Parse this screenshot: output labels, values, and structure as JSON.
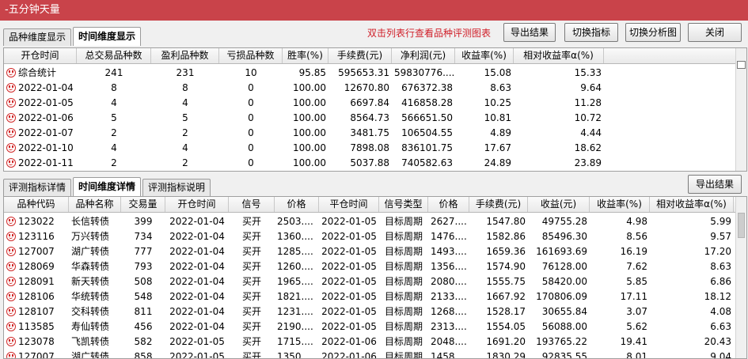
{
  "window": {
    "title": "-五分钟天量"
  },
  "top_tabs": [
    {
      "label": "品种维度显示",
      "active": false
    },
    {
      "label": "时间维度显示",
      "active": true
    }
  ],
  "hint_text": "双击列表行查看品种评测图表",
  "toolbar": {
    "export_label": "导出结果",
    "switch_indicator_label": "切换指标",
    "switch_chart_label": "切换分析图",
    "close_label": "关闭"
  },
  "summary_table": {
    "columns": [
      "开仓时间",
      "总交易品种数",
      "盈利品种数",
      "亏损品种数",
      "胜率(%)",
      "手续费(元)",
      "净利润(元)",
      "收益率(%)",
      "相对收益率α(%)"
    ],
    "rows": [
      [
        "综合统计",
        "241",
        "231",
        "10",
        "95.85",
        "595653.31",
        "59830776....",
        "15.08",
        "15.33"
      ],
      [
        "2022-01-04",
        "8",
        "8",
        "0",
        "100.00",
        "12670.80",
        "676372.38",
        "8.63",
        "9.64"
      ],
      [
        "2022-01-05",
        "4",
        "4",
        "0",
        "100.00",
        "6697.84",
        "416858.28",
        "10.25",
        "11.28"
      ],
      [
        "2022-01-06",
        "5",
        "5",
        "0",
        "100.00",
        "8564.73",
        "566651.50",
        "10.81",
        "10.72"
      ],
      [
        "2022-01-07",
        "2",
        "2",
        "0",
        "100.00",
        "3481.75",
        "106504.55",
        "4.89",
        "4.44"
      ],
      [
        "2022-01-10",
        "4",
        "4",
        "0",
        "100.00",
        "7898.08",
        "836101.75",
        "17.67",
        "18.62"
      ],
      [
        "2022-01-11",
        "2",
        "2",
        "0",
        "100.00",
        "5037.88",
        "740582.63",
        "24.89",
        "23.89"
      ]
    ]
  },
  "bottom_tabs": [
    {
      "label": "评测指标详情",
      "active": false
    },
    {
      "label": "时间维度详情",
      "active": true
    },
    {
      "label": "评测指标说明",
      "active": false
    }
  ],
  "bottom_export_label": "导出结果",
  "detail_table": {
    "columns": [
      "品种代码",
      "品种名称",
      "交易量",
      "开仓时间",
      "信号",
      "价格",
      "平仓时间",
      "信号类型",
      "价格",
      "手续费(元)",
      "收益(元)",
      "收益率(%)",
      "相对收益率α(%)"
    ],
    "rows": [
      [
        "123022",
        "长信转债",
        "399",
        "2022-01-04",
        "买开",
        "2503....",
        "2022-01-05",
        "目标周期",
        "2627....",
        "1547.80",
        "49755.28",
        "4.98",
        "5.99"
      ],
      [
        "123116",
        "万兴转债",
        "734",
        "2022-01-04",
        "买开",
        "1360....",
        "2022-01-05",
        "目标周期",
        "1476....",
        "1582.86",
        "85496.30",
        "8.56",
        "9.57"
      ],
      [
        "127007",
        "湖广转债",
        "777",
        "2022-01-04",
        "买开",
        "1285....",
        "2022-01-05",
        "目标周期",
        "1493....",
        "1659.36",
        "161693.69",
        "16.19",
        "17.20"
      ],
      [
        "128069",
        "华森转债",
        "793",
        "2022-01-04",
        "买开",
        "1260....",
        "2022-01-05",
        "目标周期",
        "1356....",
        "1574.90",
        "76128.00",
        "7.62",
        "8.63"
      ],
      [
        "128091",
        "新天转债",
        "508",
        "2022-01-04",
        "买开",
        "1965....",
        "2022-01-05",
        "目标周期",
        "2080....",
        "1555.75",
        "58420.00",
        "5.85",
        "6.86"
      ],
      [
        "128106",
        "华统转债",
        "548",
        "2022-01-04",
        "买开",
        "1821....",
        "2022-01-05",
        "目标周期",
        "2133....",
        "1667.92",
        "170806.09",
        "17.11",
        "18.12"
      ],
      [
        "128107",
        "交科转债",
        "811",
        "2022-01-04",
        "买开",
        "1231....",
        "2022-01-05",
        "目标周期",
        "1268....",
        "1528.17",
        "30655.84",
        "3.07",
        "4.08"
      ],
      [
        "113585",
        "寿仙转债",
        "456",
        "2022-01-04",
        "买开",
        "2190....",
        "2022-01-05",
        "目标周期",
        "2313....",
        "1554.05",
        "56088.00",
        "5.62",
        "6.63"
      ],
      [
        "123078",
        "飞凯转债",
        "582",
        "2022-01-05",
        "买开",
        "1715....",
        "2022-01-06",
        "目标周期",
        "2048....",
        "1691.20",
        "193765.22",
        "19.41",
        "20.43"
      ],
      [
        "127007",
        "湖广转债",
        "858",
        "2022-01-05",
        "买开",
        "1350....",
        "2022-01-06",
        "目标周期",
        "1458....",
        "1830.29",
        "92835.55",
        "8.01",
        "9.04"
      ]
    ]
  },
  "colors": {
    "titlebar": "#c9434a",
    "hint": "#d0202a",
    "smile_icon": "#d12a2a"
  }
}
